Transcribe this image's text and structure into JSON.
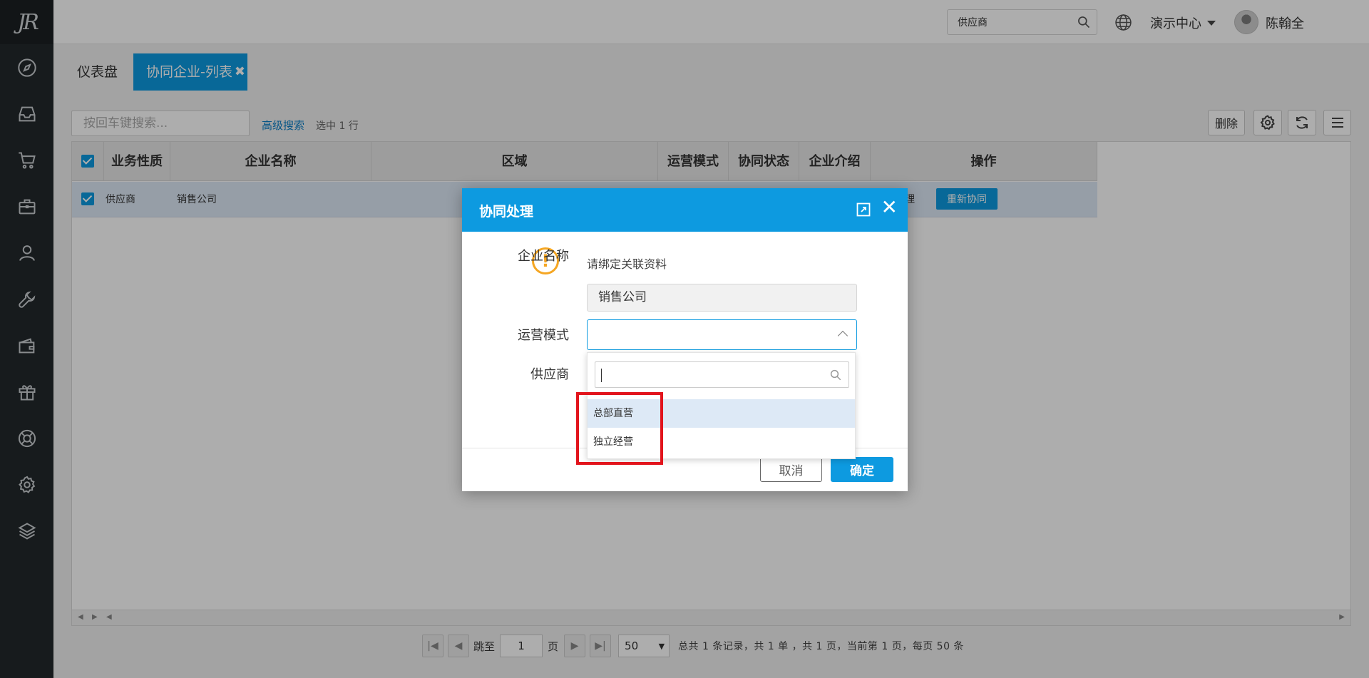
{
  "sidebar": {
    "logo_text": "JR",
    "items": [
      {
        "icon": "compass-icon"
      },
      {
        "icon": "inbox-icon"
      },
      {
        "icon": "cart-icon"
      },
      {
        "icon": "briefcase-icon"
      },
      {
        "icon": "user-icon"
      },
      {
        "icon": "wrench-icon"
      },
      {
        "icon": "wallet-icon"
      },
      {
        "icon": "gift-icon"
      },
      {
        "icon": "lifebuoy-icon"
      },
      {
        "icon": "gear-icon"
      },
      {
        "icon": "layers-icon"
      }
    ]
  },
  "header": {
    "search_value": "供应商",
    "org_label": "演示中心",
    "user_name": "陈翰全",
    "help_label": "?"
  },
  "tabs": [
    {
      "label": "仪表盘"
    },
    {
      "label": "协同企业-列表",
      "close": "✖"
    }
  ],
  "toolbar": {
    "keyword_placeholder": "按回车键搜索...",
    "advanced_search": "高级搜索",
    "selection_info": "选中 1 行",
    "delete_label": "删除"
  },
  "table": {
    "columns": [
      "业务性质",
      "企业名称",
      "区域",
      "运营模式",
      "协同状态",
      "企业介绍",
      "操作"
    ],
    "rows": [
      {
        "nature": "供应商",
        "name": "销售公司",
        "status_partial": "理",
        "action": "重新协同"
      }
    ]
  },
  "pager": {
    "goto_label": "跳至",
    "page_value": "1",
    "page_unit": "页",
    "page_size": "50",
    "info": "总共 1 条记录，共 1 单 ，共 1 页，当前第 1 页，每页 50 条"
  },
  "modal": {
    "title": "协同处理",
    "warning": "请绑定关联资料",
    "fields": {
      "company_label": "企业名称",
      "company_value": "销售公司",
      "mode_label": "运营模式",
      "supplier_label": "供应商"
    },
    "cancel_label": "取消",
    "ok_label": "确定"
  },
  "dropdown": {
    "options": [
      "总部直营",
      "独立经营"
    ],
    "highlighted_index": 0
  },
  "colors": {
    "primary": "#0d9ae0",
    "sidebar": "#23282c",
    "highlight_box": "#e2141c",
    "warning": "#f5a623"
  }
}
